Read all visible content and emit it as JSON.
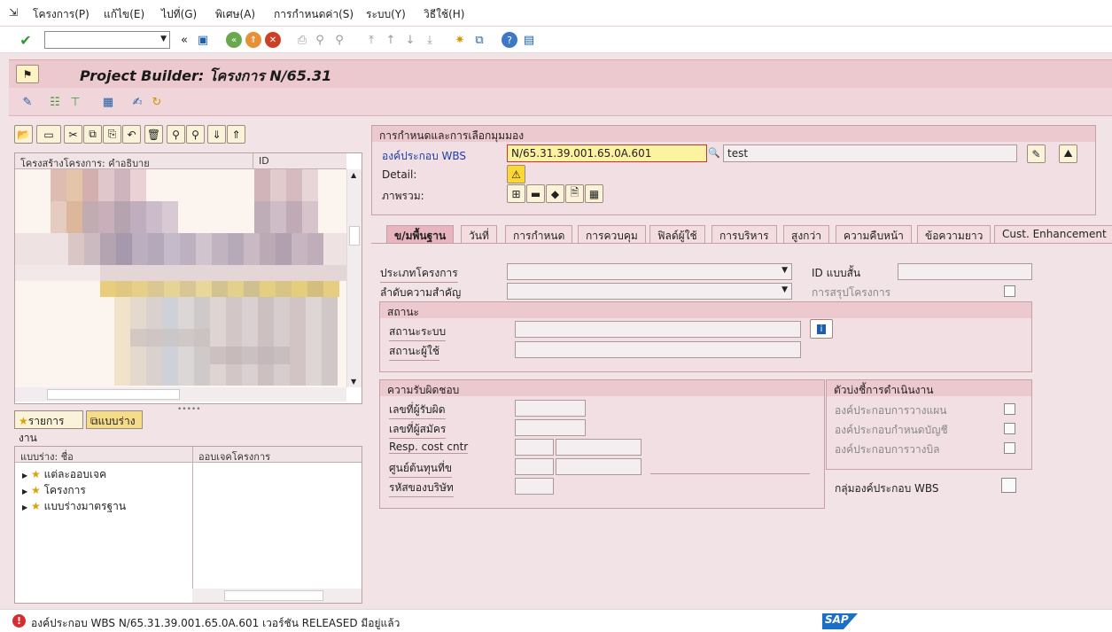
{
  "menu": [
    "โครงการ(P)",
    "แก้ไข(E)",
    "ไปที่(G)",
    "พิเศษ(A)",
    "การกำหนดค่า(S)",
    "ระบบ(Y)",
    "วิธีใช้(H)"
  ],
  "title": "Project Builder: โครงการ N/65.31",
  "tree": {
    "col1": "โครงสร้างโครงการ: คำอธิบาย",
    "col2": "ID"
  },
  "worklist_btn": "รายการงาน",
  "template_btn": "แบบร่าง",
  "template_tree": {
    "col1": "แบบร่าง: ชื่อ",
    "col2": "ออบเจคโครงการ",
    "items": [
      "แต่ละออบเจค",
      "โครงการ",
      "แบบร่างมาตรฐาน"
    ]
  },
  "header": {
    "group_title": "การกำหนดและการเลือกมุมมอง",
    "wbs_label": "องค์ประกอบ WBS",
    "wbs_value": "N/65.31.39.001.65.0A.601",
    "wbs_desc": "test",
    "detail_label": "Detail:",
    "overview_label": "ภาพรวม:"
  },
  "tabs": [
    "ข/มพื้นฐาน",
    "วันที่",
    "การกำหนด",
    "การควบคุม",
    "ฟิลด์ผู้ใช้",
    "การบริหาร",
    "สูงกว่า",
    "ความคืบหน้า",
    "ข้อความยาว",
    "Cust. Enhancement"
  ],
  "basic": {
    "project_type": "ประเภทโครงการ",
    "priority": "ลำดับความสำคัญ",
    "short_id": "ID แบบสั้น",
    "proj_summary": "การสรุปโครงการ",
    "status_title": "สถานะ",
    "system_status": "สถานะระบบ",
    "user_status": "สถานะผู้ใช้",
    "resp_title": "ความรับผิดชอบ",
    "resp_person": "เลขที่ผู้รับผิด",
    "applicant": "เลขที่ผู้สมัคร",
    "resp_cc": "Resp. cost cntr",
    "req_cc": "ศูนย์ต้นทุนที่ข",
    "company": "รหัสของบริษัท",
    "op_title": "ตัวบ่งชี้การดำเนินงาน",
    "planning": "องค์ประกอบการวางแผน",
    "acct": "องค์ประกอบกำหนดบัญชี",
    "billing": "องค์ประกอบการวางบิล",
    "grouping": "กลุ่มองค์ประกอบ WBS"
  },
  "status_message": "องค์ประกอบ WBS N/65.31.39.001.65.0A.601 เวอร์ชัน RELEASED มีอยู่แล้ว",
  "sap_logo": "SAP"
}
